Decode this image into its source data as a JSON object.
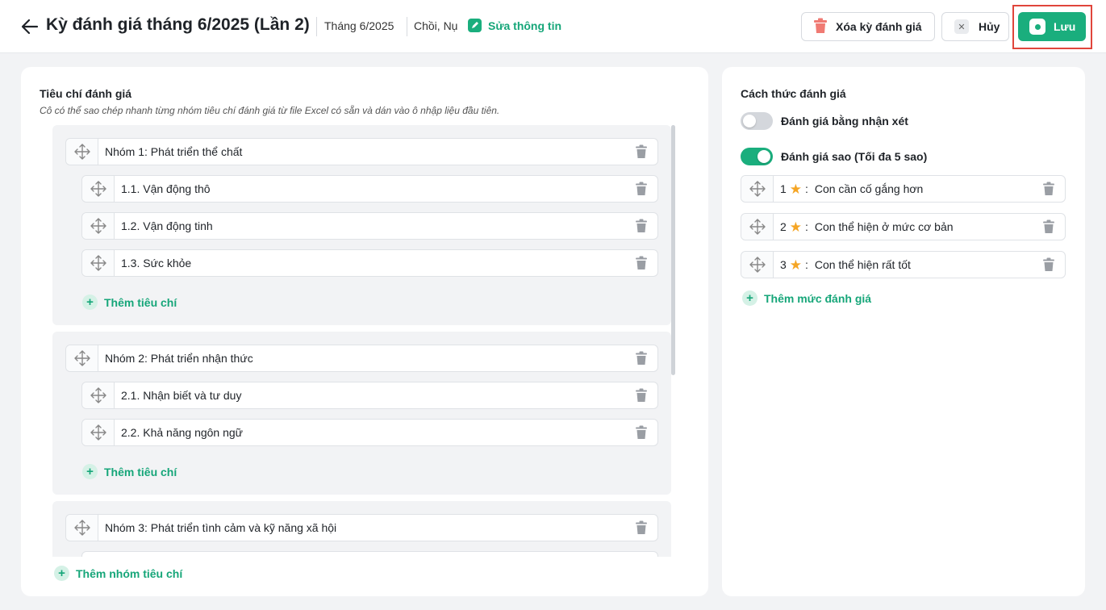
{
  "header": {
    "title": "Kỳ đánh giá tháng 6/2025 (Lần 2)",
    "month": "Tháng 6/2025",
    "classes": "Chồi, Nụ",
    "edit_label": "Sửa thông tin",
    "delete_label": "Xóa kỳ đánh giá",
    "cancel_label": "Hủy",
    "save_label": "Lưu"
  },
  "criteria": {
    "title": "Tiêu chí đánh giá",
    "hint": "Cô có thể sao chép nhanh từng nhóm tiêu chí đánh giá từ file Excel có sẵn và dán vào ô nhập liệu đầu tiên.",
    "groups": [
      {
        "name": "Nhóm 1: Phát triển thể chất",
        "items": [
          "1.1. Vận động thô",
          "1.2. Vận động tinh",
          "1.3. Sức khỏe"
        ],
        "add_label": "Thêm tiêu chí"
      },
      {
        "name": "Nhóm 2: Phát triển nhận thức",
        "items": [
          "2.1. Nhận biết và tư duy",
          "2.2. Khả năng ngôn ngữ"
        ],
        "add_label": "Thêm tiêu chí"
      },
      {
        "name": "Nhóm 3: Phát triển tình cảm và kỹ năng xã hội",
        "items": [],
        "add_label": ""
      }
    ],
    "add_group_label": "Thêm nhóm tiêu chí"
  },
  "method": {
    "title": "Cách thức đánh giá",
    "comment_toggle": {
      "label": "Đánh giá bằng nhận xét",
      "on": false
    },
    "star_toggle": {
      "label": "Đánh giá sao (Tối đa 5 sao)",
      "on": true
    },
    "levels": [
      {
        "stars": "1",
        "text": "Con cần cố gắng hơn"
      },
      {
        "stars": "2",
        "text": "Con thể hiện ở mức cơ bản"
      },
      {
        "stars": "3",
        "text": "Con thể hiện rất tốt"
      }
    ],
    "add_level_label": "Thêm mức đánh giá"
  },
  "colors": {
    "accent": "#1aae7d",
    "highlight": "#e0453b",
    "star": "#f5a524"
  }
}
